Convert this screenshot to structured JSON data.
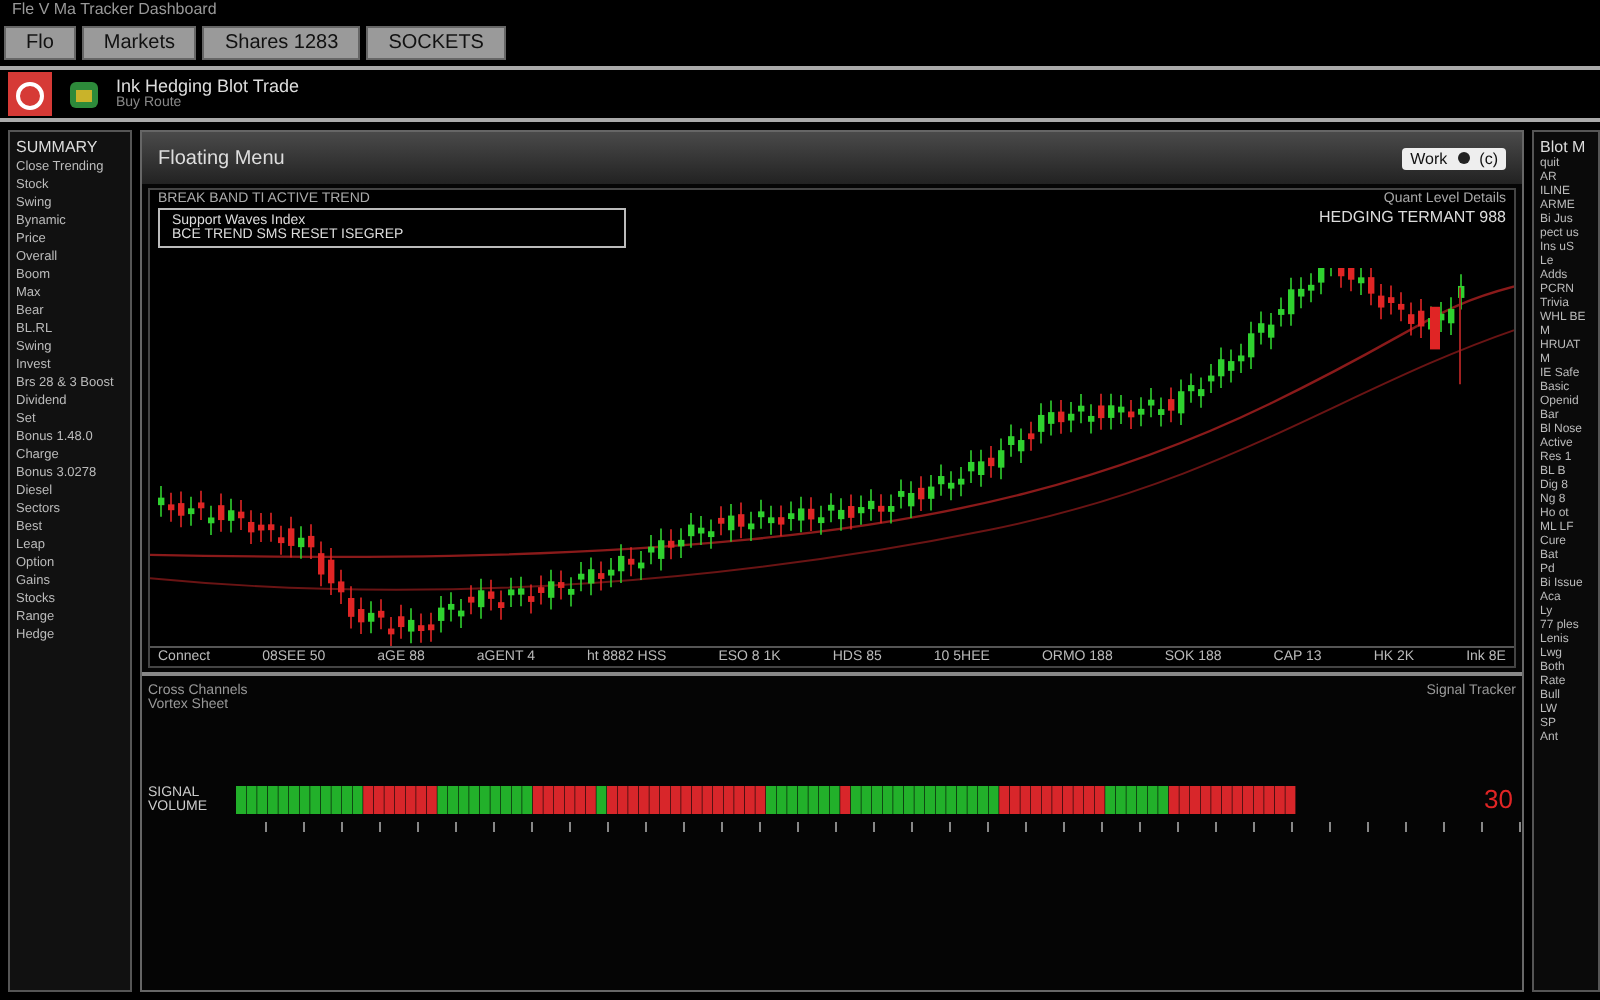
{
  "top_caption": "Fle V Ma Tracker Dashboard",
  "tabs": [
    {
      "label": "Flo"
    },
    {
      "label": "Markets"
    },
    {
      "label": "Shares 1283"
    },
    {
      "label": "SOCKETS"
    }
  ],
  "app": {
    "title": "Ink Hedging Blot Trade",
    "subtitle": "Buy Route"
  },
  "left_panel": {
    "title": "SUMMARY",
    "items": [
      "Close  Trending",
      "Stock",
      "Swing",
      "Bynamic",
      "Price",
      "Overall",
      "Boom",
      "Max",
      "Bear",
      "BL.RL",
      "Swing",
      "Invest",
      "Brs 28 & 3 Boost",
      "Dividend",
      "Set",
      "Bonus 1.48.0",
      "Charge",
      "Bonus 3.0278",
      "Diesel",
      "Sectors",
      "Best",
      "Leap",
      "Option",
      "Gains",
      "Stocks",
      "Range",
      "Hedge"
    ]
  },
  "panel": {
    "title": "Floating Menu",
    "action": "Work",
    "action_extra": "(c)"
  },
  "chart": {
    "header": "BREAK BAND TI ACTIVE TREND",
    "legend": [
      "Support  Waves  Index",
      "BCE TREND SMS RESET ISEGREP"
    ],
    "corner": "Quant Level Details",
    "right_label": "HEDGING TERMANT 988",
    "axis_labels": [
      "Connect",
      "08SEE 50",
      "aGE 88",
      "aGENT 4",
      "ht 8882 HSS",
      "ESO 8 1K",
      "HDS 85",
      "10 5HEE",
      "ORMO 188",
      "SOK 188",
      "CAP 13",
      "HK 2K",
      "Ink 8E"
    ]
  },
  "lower": {
    "title": "Cross Channels",
    "subtitle": "Vortex Sheet",
    "corner": "Signal Tracker",
    "row_label": "SIGNAL",
    "row_label_2": "VOLUME",
    "value": "30"
  },
  "right_panel": {
    "title": "Blot M",
    "items": [
      "quit",
      "AR",
      "ILINE",
      "ARME",
      "Bi Jus",
      "pect us",
      "Ins uS",
      "Le",
      "Adds",
      "PCRN",
      "Trivia",
      "WHL BE",
      "M",
      "HRUAT",
      "M",
      "IE Safe",
      "Basic",
      "Openid",
      "Bar",
      "Bl Nose",
      "Active",
      "Res 1",
      "BL B",
      "Dig 8",
      "Ng 8",
      "Ho ot",
      "ML LF",
      "Cure",
      "Bat",
      "Pd",
      "Bi Issue",
      "Aca",
      "Ly",
      "77 ples",
      "Lenis",
      "Lwg",
      "Both",
      "Rate",
      "Bull",
      "LW",
      "SP",
      "Ant"
    ]
  }
}
